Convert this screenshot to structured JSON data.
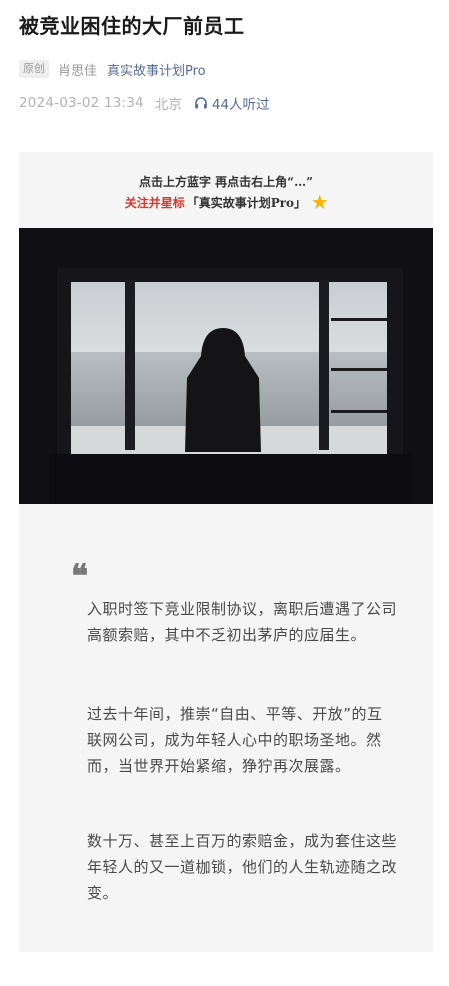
{
  "article": {
    "title": "被竞业困住的大厂前员工",
    "original_tag": "原创",
    "author": "肖思佳",
    "account": "真实故事计划Pro",
    "date": "2024-03-02 13:34",
    "location": "北京",
    "listen_count": "44人听过"
  },
  "follow_banner": {
    "line1": "点击上方蓝字 再点击右上角“…”",
    "line2_prefix": "关注并星标",
    "line2_account": "「真实故事计划Pro」",
    "star_icon": "star-icon"
  },
  "quote_mark": "❝",
  "paragraphs": [
    "入职时签下竞业限制协议，离职后遭遇了公司高额索赔，其中不乏初出茅庐的应届生。",
    "过去十年间，推崇“自由、平等、开放”的互联网公司，成为年轻人心中的职场圣地。然而，当世界开始紧缩，狰狞再次展露。",
    "数十万、甚至上百万的索赔金，成为套住这些年轻人的又一道枷锁，他们的人生轨迹随之改变。"
  ],
  "colors": {
    "link": "#576b95",
    "accent_red": "#d43b2f",
    "star": "#f5b400",
    "card_bg": "#f5f5f5"
  }
}
